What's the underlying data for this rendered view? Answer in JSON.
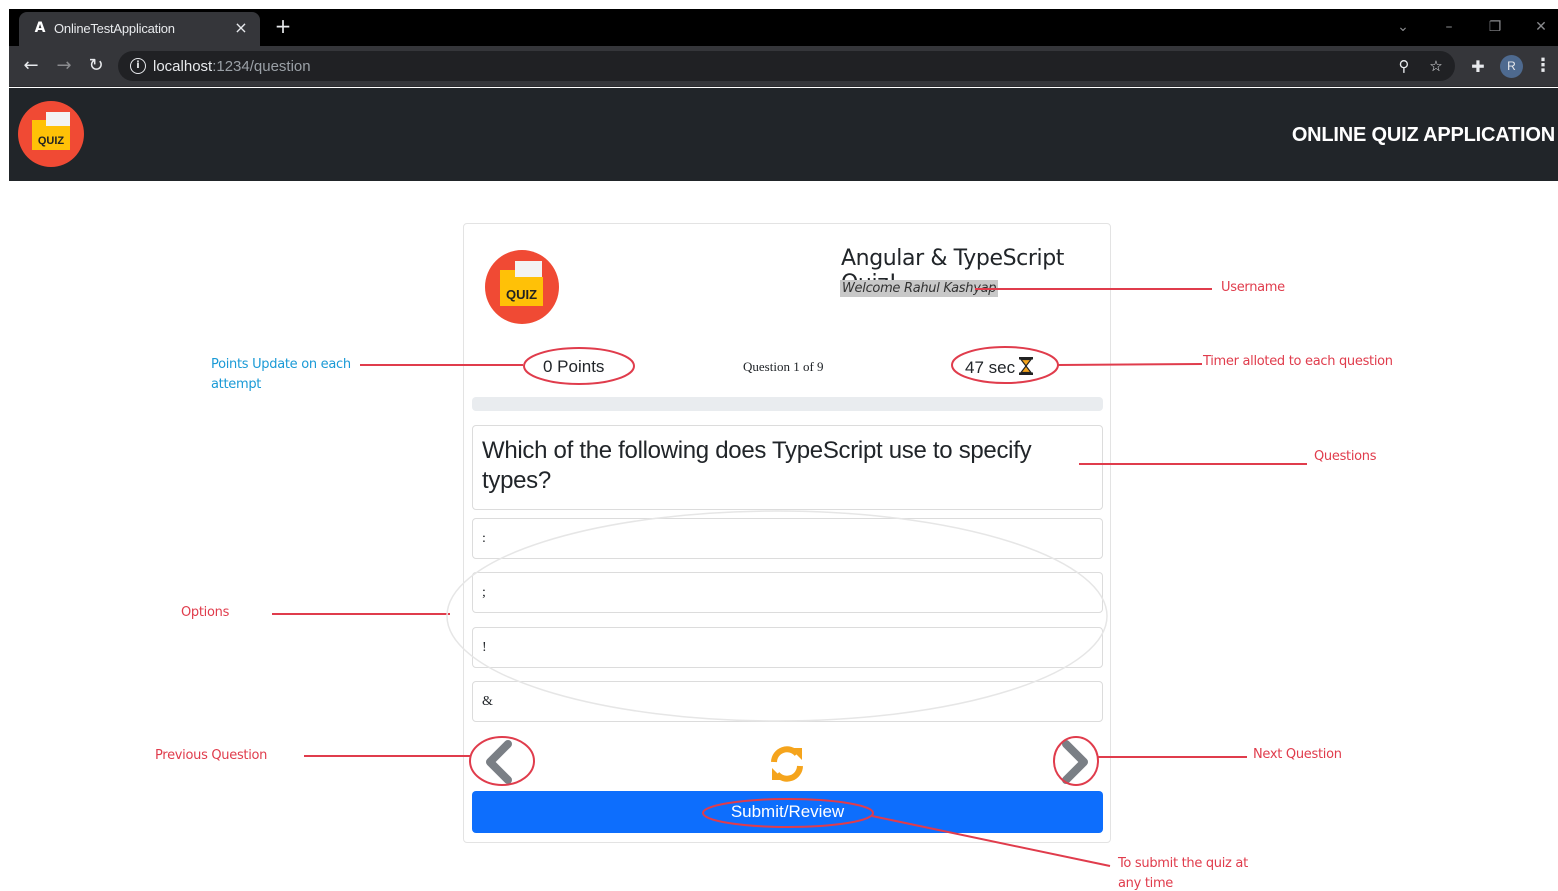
{
  "browser": {
    "tab_title": "OnlineTestApplication",
    "tab_favicon": "A",
    "tab_close": "×",
    "new_tab": "+",
    "url_host": "localhost",
    "url_rest": ":1234/question",
    "profile_initial": "R"
  },
  "navbar": {
    "brand": "ONLINE QUIZ APPLICATION",
    "logo_text": "QUIZ"
  },
  "quiz": {
    "logo_text": "QUIZ",
    "title": "Angular & TypeScript Quiz!",
    "welcome": "Welcome Rahul Kashyap",
    "points": "0 Points",
    "question_counter": "Question 1 of 9",
    "timer": "47 sec",
    "progress_percent": 0,
    "question": "Which of the following does TypeScript use to specify types?",
    "options": [
      ":",
      ";",
      "!",
      "&"
    ],
    "submit_label": "Submit/Review"
  },
  "annotations": {
    "username": "Username",
    "points": "Points Update on each attempt",
    "timer": "Timer alloted to each question",
    "questions": "Questions",
    "options": "Options",
    "previous": "Previous Question",
    "next": "Next Question",
    "submit": "To submit the quiz at any time"
  },
  "colors": {
    "navbar_bg": "#212529",
    "primary": "#0d6efd",
    "annotation_red": "#e03c4c",
    "annotation_blue": "#1a9ad6",
    "refresh_orange": "#f5a41c",
    "logo_red": "#f04a34",
    "logo_yellow": "#ffc107"
  },
  "icons": {
    "back": "arrow-left-icon",
    "forward": "arrow-right-icon",
    "reload": "reload-icon",
    "info": "info-icon",
    "zoom": "zoom-icon",
    "bookmark": "star-icon",
    "extensions": "puzzle-icon",
    "menu": "kebab-menu-icon",
    "timer": "hourglass-icon",
    "prev": "chevron-left-icon",
    "next": "chevron-right-icon",
    "refresh": "refresh-icon"
  }
}
